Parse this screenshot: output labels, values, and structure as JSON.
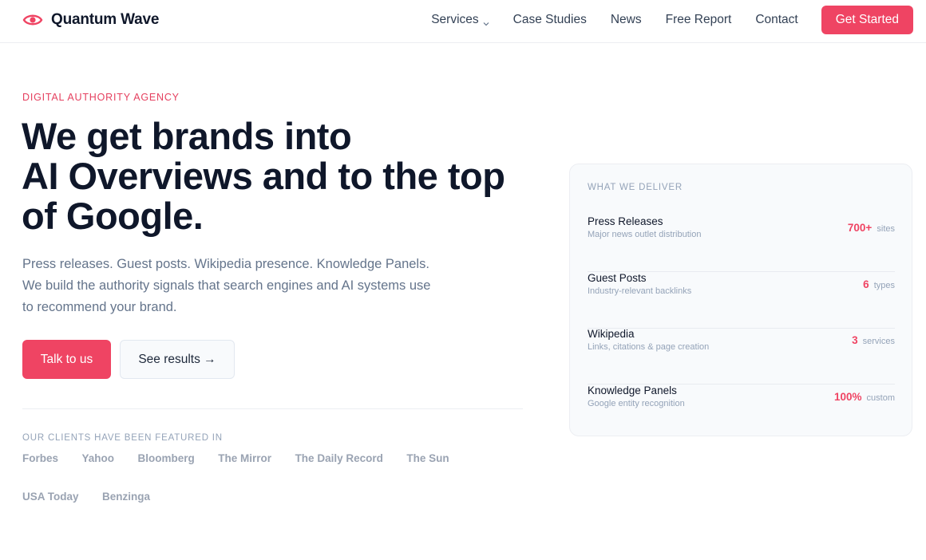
{
  "brand": {
    "name": "Quantum Wave",
    "accent_color": "#ef4463",
    "logo_icon": "eye-icon"
  },
  "nav": {
    "items": [
      {
        "label": "Services",
        "has_dropdown": true
      },
      {
        "label": "Case Studies"
      },
      {
        "label": "News"
      },
      {
        "label": "Free Report"
      },
      {
        "label": "Contact"
      }
    ],
    "cta": "Get Started"
  },
  "hero": {
    "eyebrow": "DIGITAL AUTHORITY AGENCY",
    "headline": [
      "We get brands into",
      "AI Overviews and to the top",
      "of Google."
    ],
    "lede": "Press releases. Guest posts. Wikipedia presence. Knowledge Panels. We build the authority signals that search engines and AI systems use to recommend your brand.",
    "primary_button": "Talk to us",
    "secondary_button": "See results →"
  },
  "featured": {
    "label": "OUR CLIENTS HAVE BEEN FEATURED IN",
    "logos": [
      "Forbes",
      "Yahoo",
      "Bloomberg",
      "The Mirror",
      "The Daily Record",
      "The Sun",
      "USA Today",
      "Benzinga"
    ]
  },
  "deliver": {
    "title": "WHAT WE DELIVER",
    "rows": [
      {
        "title": "Press Releases",
        "subtitle": "Major news outlet distribution",
        "value": "700+",
        "unit": "sites"
      },
      {
        "title": "Guest Posts",
        "subtitle": "Industry-relevant backlinks",
        "value": "6",
        "unit": "types"
      },
      {
        "title": "Wikipedia",
        "subtitle": "Links, citations & page creation",
        "value": "3",
        "unit": "services"
      },
      {
        "title": "Knowledge Panels",
        "subtitle": "Google entity recognition",
        "value": "100%",
        "unit": "custom"
      }
    ]
  }
}
